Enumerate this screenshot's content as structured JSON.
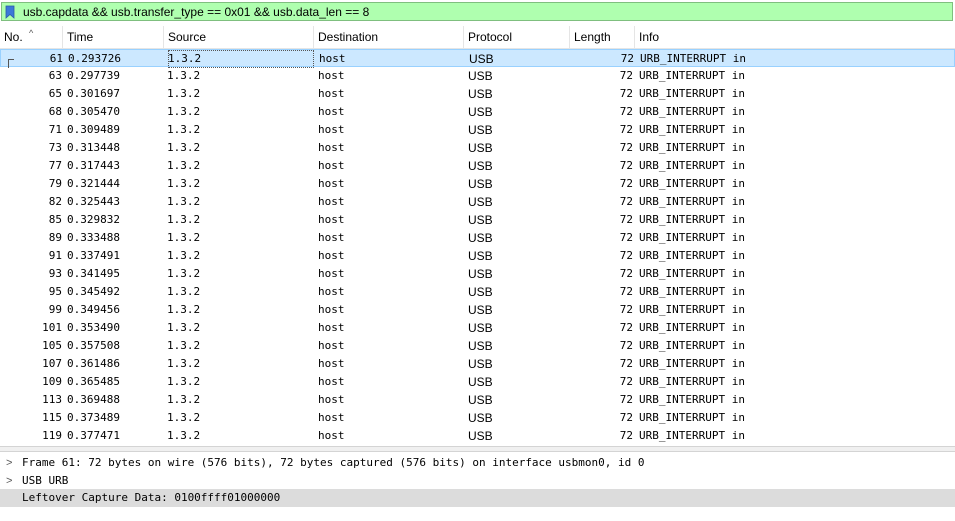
{
  "filter": {
    "text": "usb.capdata && usb.transfer_type == 0x01 && usb.data_len == 8",
    "bookmark_icon": "bookmark-icon",
    "background": "#afffaf"
  },
  "columns": {
    "no": "No.",
    "time": "Time",
    "source": "Source",
    "destination": "Destination",
    "protocol": "Protocol",
    "length": "Length",
    "info": "Info",
    "sort_indicator": "^"
  },
  "packets": [
    {
      "no": "61",
      "time": "0.293726",
      "source": "1.3.2",
      "destination": "host",
      "protocol": "USB",
      "length": "72",
      "info": "URB_INTERRUPT in"
    },
    {
      "no": "63",
      "time": "0.297739",
      "source": "1.3.2",
      "destination": "host",
      "protocol": "USB",
      "length": "72",
      "info": "URB_INTERRUPT in"
    },
    {
      "no": "65",
      "time": "0.301697",
      "source": "1.3.2",
      "destination": "host",
      "protocol": "USB",
      "length": "72",
      "info": "URB_INTERRUPT in"
    },
    {
      "no": "68",
      "time": "0.305470",
      "source": "1.3.2",
      "destination": "host",
      "protocol": "USB",
      "length": "72",
      "info": "URB_INTERRUPT in"
    },
    {
      "no": "71",
      "time": "0.309489",
      "source": "1.3.2",
      "destination": "host",
      "protocol": "USB",
      "length": "72",
      "info": "URB_INTERRUPT in"
    },
    {
      "no": "73",
      "time": "0.313448",
      "source": "1.3.2",
      "destination": "host",
      "protocol": "USB",
      "length": "72",
      "info": "URB_INTERRUPT in"
    },
    {
      "no": "77",
      "time": "0.317443",
      "source": "1.3.2",
      "destination": "host",
      "protocol": "USB",
      "length": "72",
      "info": "URB_INTERRUPT in"
    },
    {
      "no": "79",
      "time": "0.321444",
      "source": "1.3.2",
      "destination": "host",
      "protocol": "USB",
      "length": "72",
      "info": "URB_INTERRUPT in"
    },
    {
      "no": "82",
      "time": "0.325443",
      "source": "1.3.2",
      "destination": "host",
      "protocol": "USB",
      "length": "72",
      "info": "URB_INTERRUPT in"
    },
    {
      "no": "85",
      "time": "0.329832",
      "source": "1.3.2",
      "destination": "host",
      "protocol": "USB",
      "length": "72",
      "info": "URB_INTERRUPT in"
    },
    {
      "no": "89",
      "time": "0.333488",
      "source": "1.3.2",
      "destination": "host",
      "protocol": "USB",
      "length": "72",
      "info": "URB_INTERRUPT in"
    },
    {
      "no": "91",
      "time": "0.337491",
      "source": "1.3.2",
      "destination": "host",
      "protocol": "USB",
      "length": "72",
      "info": "URB_INTERRUPT in"
    },
    {
      "no": "93",
      "time": "0.341495",
      "source": "1.3.2",
      "destination": "host",
      "protocol": "USB",
      "length": "72",
      "info": "URB_INTERRUPT in"
    },
    {
      "no": "95",
      "time": "0.345492",
      "source": "1.3.2",
      "destination": "host",
      "protocol": "USB",
      "length": "72",
      "info": "URB_INTERRUPT in"
    },
    {
      "no": "99",
      "time": "0.349456",
      "source": "1.3.2",
      "destination": "host",
      "protocol": "USB",
      "length": "72",
      "info": "URB_INTERRUPT in"
    },
    {
      "no": "101",
      "time": "0.353490",
      "source": "1.3.2",
      "destination": "host",
      "protocol": "USB",
      "length": "72",
      "info": "URB_INTERRUPT in"
    },
    {
      "no": "105",
      "time": "0.357508",
      "source": "1.3.2",
      "destination": "host",
      "protocol": "USB",
      "length": "72",
      "info": "URB_INTERRUPT in"
    },
    {
      "no": "107",
      "time": "0.361486",
      "source": "1.3.2",
      "destination": "host",
      "protocol": "USB",
      "length": "72",
      "info": "URB_INTERRUPT in"
    },
    {
      "no": "109",
      "time": "0.365485",
      "source": "1.3.2",
      "destination": "host",
      "protocol": "USB",
      "length": "72",
      "info": "URB_INTERRUPT in"
    },
    {
      "no": "113",
      "time": "0.369488",
      "source": "1.3.2",
      "destination": "host",
      "protocol": "USB",
      "length": "72",
      "info": "URB_INTERRUPT in"
    },
    {
      "no": "115",
      "time": "0.373489",
      "source": "1.3.2",
      "destination": "host",
      "protocol": "USB",
      "length": "72",
      "info": "URB_INTERRUPT in"
    },
    {
      "no": "119",
      "time": "0.377471",
      "source": "1.3.2",
      "destination": "host",
      "protocol": "USB",
      "length": "72",
      "info": "URB_INTERRUPT in"
    }
  ],
  "selected_packet": "61",
  "selection_color": "#cce8ff",
  "details": [
    {
      "text": "Frame 61: 72 bytes on wire (576 bits), 72 bytes captured (576 bits) on interface usbmon0, id 0",
      "expander": ">",
      "highlight": false
    },
    {
      "text": "USB URB",
      "expander": ">",
      "highlight": false
    },
    {
      "text": "Leftover Capture Data: 0100ffff01000000",
      "expander": "",
      "highlight": true
    }
  ]
}
